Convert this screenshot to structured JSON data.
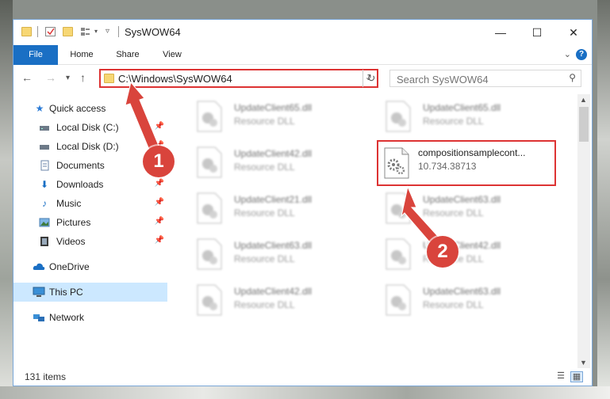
{
  "window": {
    "title": "SysWOW64",
    "minimize_glyph": "—",
    "maximize_glyph": "☐",
    "close_glyph": "✕"
  },
  "ribbon": {
    "tabs": [
      "File",
      "Home",
      "Share",
      "View"
    ],
    "help_glyph": "?",
    "collapse_glyph": "⌄"
  },
  "address": {
    "path": "C:\\Windows\\SysWOW64",
    "search_placeholder": "Search SysWOW64"
  },
  "sidebar": {
    "items": [
      {
        "label": "Quick access",
        "icon": "star-icon"
      },
      {
        "label": "Local Disk (C:)",
        "icon": "drive-icon",
        "pinned": true
      },
      {
        "label": "Local Disk (D:)",
        "icon": "drive-icon",
        "pinned": true
      },
      {
        "label": "Documents",
        "icon": "documents-icon",
        "pinned": true
      },
      {
        "label": "Downloads",
        "icon": "downloads-icon",
        "pinned": true
      },
      {
        "label": "Music",
        "icon": "music-icon",
        "pinned": true
      },
      {
        "label": "Pictures",
        "icon": "pictures-icon",
        "pinned": true
      },
      {
        "label": "Videos",
        "icon": "videos-icon",
        "pinned": true
      },
      {
        "label": "OneDrive",
        "icon": "cloud-icon"
      },
      {
        "label": "This PC",
        "icon": "computer-icon",
        "selected": true
      },
      {
        "label": "Network",
        "icon": "network-icon"
      }
    ]
  },
  "files": {
    "left_column": [
      {
        "name": "UpdateClient65.dll",
        "type": "Resource DLL"
      },
      {
        "name": "UpdateClient42.dll",
        "type": "Resource DLL"
      },
      {
        "name": "UpdateClient21.dll",
        "type": "Resource DLL"
      },
      {
        "name": "UpdateClient63.dll",
        "type": "Resource DLL"
      },
      {
        "name": "UpdateClient42.dll",
        "type": "Resource DLL"
      }
    ],
    "right_column": [
      {
        "name": "UpdateClient65.dll",
        "type": "Resource DLL"
      },
      {
        "name": "compositionsamplecont...",
        "type": "10.734.38713",
        "highlighted": true
      },
      {
        "name": "UpdateClient63.dll",
        "type": "Resource DLL"
      },
      {
        "name": "UpdateClient42.dll",
        "type": "Resource DLL"
      },
      {
        "name": "UpdateClient63.dll",
        "type": "Resource DLL"
      }
    ]
  },
  "status": {
    "item_count": "131 items"
  },
  "callouts": [
    "1",
    "2"
  ],
  "colors": {
    "accent": "#1a6fc4",
    "highlight_box": "#dd3333",
    "callout": "#d9443c",
    "selected_nav": "#cce8ff"
  }
}
